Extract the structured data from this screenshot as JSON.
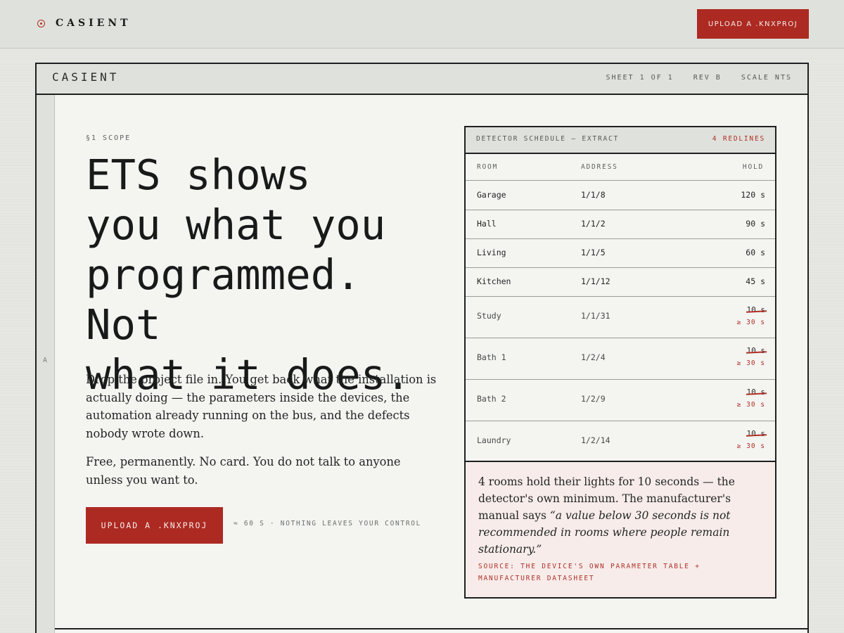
{
  "brand": {
    "name": "CASIENT",
    "accent": "#ac2a22"
  },
  "header": {
    "cta_label": "UPLOAD A .KNXPROJ"
  },
  "sheet": {
    "title": "CASIENT",
    "meta": [
      "SHEET 1 OF 1",
      "REV B",
      "SCALE NTS"
    ],
    "margin_letter": "A"
  },
  "hero": {
    "section_label": "§1  SCOPE",
    "headline_lines": [
      "ETS shows",
      "you what you",
      "programmed. Not",
      "what it does."
    ],
    "paragraph_1": "Drop the project file in. You get back what the installation is actually doing — the parameters inside the devices, the automation already running on the bus, and the defects nobody wrote down.",
    "paragraph_2": "Free, permanently. No card. You do not talk to anyone unless you want to.",
    "cta_label": "UPLOAD A .KNXPROJ",
    "cta_note": "≈ 60 S · NOTHING LEAVES YOUR CONTROL"
  },
  "schedule": {
    "title": "DETECTOR SCHEDULE — EXTRACT",
    "badge": "4 REDLINES",
    "columns": [
      "ROOM",
      "ADDRESS",
      "HOLD"
    ],
    "rows": [
      {
        "room": "Garage",
        "address": "1/1/8",
        "hold": "120 s"
      },
      {
        "room": "Hall",
        "address": "1/1/2",
        "hold": "90 s"
      },
      {
        "room": "Living",
        "address": "1/1/5",
        "hold": "60 s"
      },
      {
        "room": "Kitchen",
        "address": "1/1/12",
        "hold": "45 s"
      },
      {
        "room": "Study",
        "address": "1/1/31",
        "hold": "10 s",
        "corrected": "≥ 30 s"
      },
      {
        "room": "Bath 1",
        "address": "1/2/4",
        "hold": "10 s",
        "corrected": "≥ 30 s"
      },
      {
        "room": "Bath 2",
        "address": "1/2/9",
        "hold": "10 s",
        "corrected": "≥ 30 s"
      },
      {
        "room": "Laundry",
        "address": "1/2/14",
        "hold": "10 s",
        "corrected": "≥ 30 s"
      }
    ],
    "note_text": "4 rooms hold their lights for 10 seconds — the detector's own minimum. The manufacturer's manual says ",
    "note_quote": "“a value below 30 seconds is not recommended in rooms where people remain stationary.”",
    "note_source": "SOURCE: THE DEVICE'S OWN PARAMETER TABLE + MANUFACTURER DATASHEET"
  }
}
